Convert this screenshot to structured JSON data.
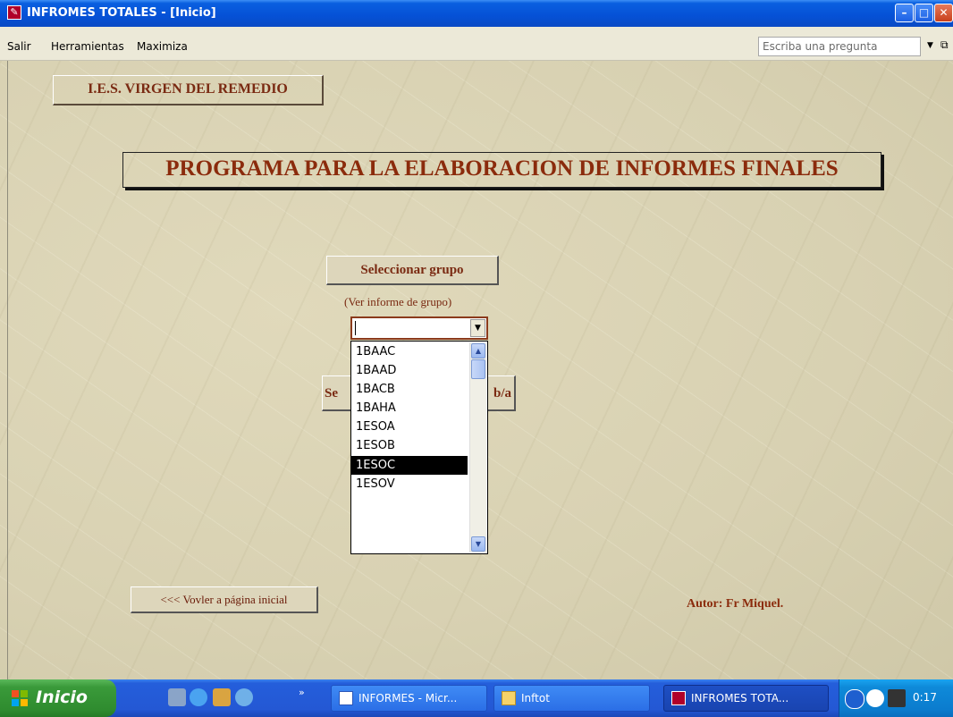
{
  "window": {
    "title": "INFROMES TOTALES - [Inicio]",
    "minimize_glyph": "–",
    "maximize_glyph": "□",
    "close_glyph": "✕"
  },
  "menubar": {
    "items": [
      "Salir",
      "Herramientas",
      "Maximiza"
    ],
    "help_placeholder": "Escriba una pregunta"
  },
  "form": {
    "school_name": "I.E.S. VIRGEN DEL REMEDIO",
    "main_title": "PROGRAMA PARA LA ELABORACION DE INFORMES FINALES",
    "select_group_button": "Seleccionar grupo",
    "group_hint": "(Ver informe de grupo)",
    "select_student_button_left": "Se",
    "select_student_button_right": "b/a",
    "back_button": "<<< Vovler a página inicial",
    "author": "Autor: Fr Miquel."
  },
  "group_combo": {
    "value": "",
    "options": [
      "1BAAC",
      "1BAAD",
      "1BACB",
      "1BAHA",
      "1ESOA",
      "1ESOB",
      "1ESOC",
      "1ESOV"
    ],
    "selected": "1ESOC"
  },
  "taskbar": {
    "start_label": "Inicio",
    "buttons": [
      {
        "label": "INFORMES - Micr...",
        "icon": "word-icon"
      },
      {
        "label": "Inftot",
        "icon": "folder-icon"
      },
      {
        "label": "INFROMES TOTA...",
        "icon": "access-icon"
      }
    ],
    "clock": "0:17"
  },
  "colors": {
    "title_text": "#8b2b0c",
    "xp_blue": "#245edb",
    "start_green": "#3a9a3a"
  }
}
